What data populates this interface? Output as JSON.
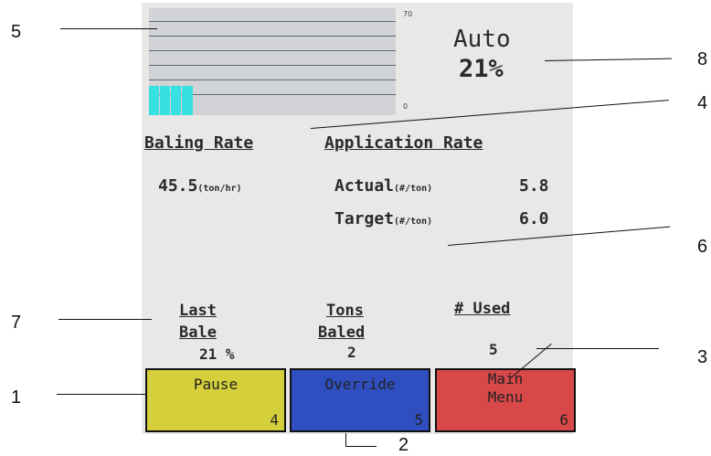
{
  "graph": {
    "y_max_label": "70",
    "y_min_label": "0",
    "fill_fraction": 0.2
  },
  "mode": {
    "label": "Auto",
    "percent": "21%"
  },
  "headers": {
    "baling_rate": "Baling Rate",
    "application_rate": "Application Rate"
  },
  "baling_rate": {
    "value": "45.5",
    "unit": "(ton/hr)"
  },
  "application": {
    "actual_label": "Actual",
    "actual_unit": "(#/ton)",
    "actual_value": "5.8",
    "target_label": "Target",
    "target_unit": "(#/ton)",
    "target_value": "6.0"
  },
  "stats": {
    "last_bale_line1": "Last",
    "last_bale_line2": "Bale",
    "last_bale_value": "21 %",
    "tons_baled_line1": "Tons",
    "tons_baled_line2": "Baled",
    "tons_baled_value": "2",
    "used_label": "# Used",
    "used_value": "5"
  },
  "buttons": {
    "pause": {
      "label": "Pause",
      "number": "4",
      "color": "#d4cf3a"
    },
    "override": {
      "label": "Override",
      "number": "5",
      "color": "#2f4fc0"
    },
    "main_menu": {
      "line1": "Main",
      "line2": "Menu",
      "number": "6",
      "color": "#d84848"
    }
  },
  "callouts": [
    "1",
    "2",
    "3",
    "4",
    "5",
    "6",
    "7",
    "8"
  ]
}
